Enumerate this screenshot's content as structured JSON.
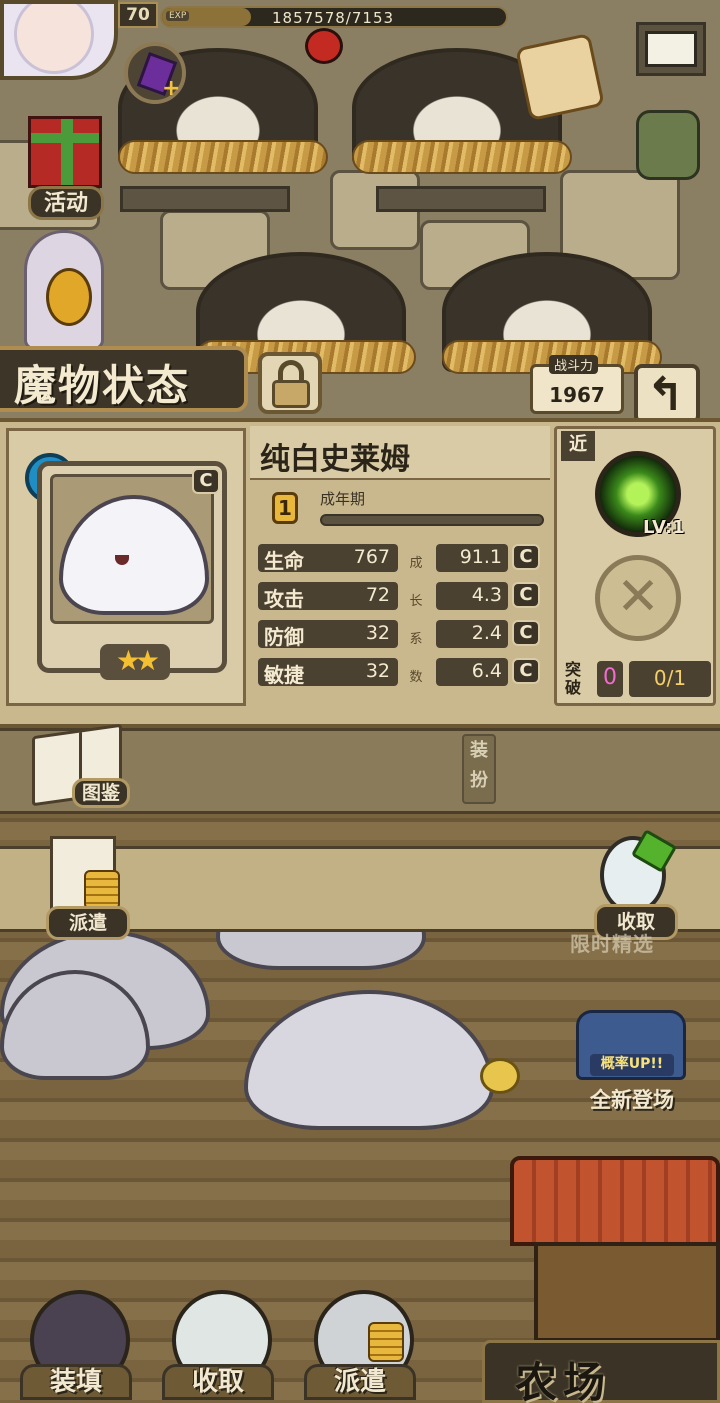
{
  "hud": {
    "player_level": "70",
    "exp_tag": "EXP",
    "exp_text": "1857578/7153",
    "exp_progress": 0.26
  },
  "side_buttons": {
    "event_label": "活动",
    "catalog_label": "图鉴",
    "dispatch_label": "派遣",
    "collect_label": "收取",
    "limited_label": "限时精选",
    "new_rate_up": "概率UP!!",
    "new_label": "全新登场",
    "dress_label": "装扮"
  },
  "status": {
    "title": "魔物状态",
    "power_label": "战斗力",
    "power_value": "1967",
    "monster_name": "纯白史莱姆",
    "growth_level": "1",
    "growth_stage": "成年期",
    "growth_progress": 0.0,
    "card_rank": "C",
    "star_count": 2,
    "element_icon": "water-element-icon",
    "stats": [
      {
        "label": "生命",
        "value": "767",
        "growth": "91.1",
        "rank": "C"
      },
      {
        "label": "攻击",
        "value": "72",
        "growth": "4.3",
        "rank": "C"
      },
      {
        "label": "防御",
        "value": "32",
        "growth": "2.4",
        "rank": "C"
      },
      {
        "label": "敏捷",
        "value": "32",
        "growth": "6.4",
        "rank": "C"
      }
    ],
    "growth_coef_chars": [
      "成",
      "长",
      "系",
      "数"
    ],
    "range_tag": "近",
    "skill_level": "LV:1",
    "break_label": "突破",
    "break_count": "0",
    "break_progress": "0/1"
  },
  "bottom_nav": {
    "load_label": "装填",
    "collect_label": "收取",
    "dispatch_label": "派遣",
    "farm_label": "农场"
  },
  "colors": {
    "panel": "#c9b88e",
    "dark_plate": "#3b3426",
    "accent_gold": "#f4c031",
    "break_pink": "#f06bd2"
  }
}
